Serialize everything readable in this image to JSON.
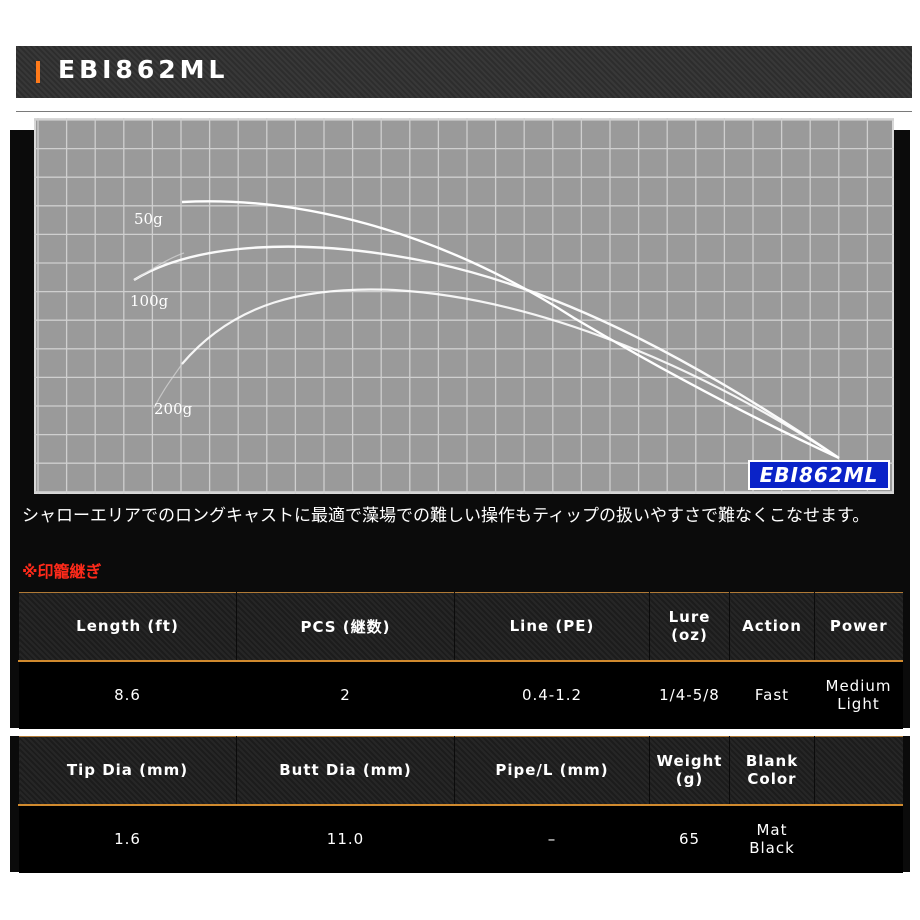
{
  "header": {
    "title": "EBI862ML"
  },
  "chart": {
    "labels": [
      "50g",
      "100g",
      "200g"
    ],
    "badge": "EBI862ML",
    "colors": {
      "bg": "#9a9a9a",
      "grid": "#cfcfcf",
      "curve": "#ffffff",
      "badge": "#0a23c8"
    }
  },
  "description": "シャローエリアでのロングキャストに最適で藻場での難しい操作もティップの扱いやすさで難なくこなせます。",
  "note": "※印籠継ぎ",
  "spec1": {
    "headers": [
      "Length (ft)",
      "PCS (継数)",
      "Line (PE)",
      "Lure (oz)",
      "Action",
      "Power"
    ],
    "values": [
      "8.6",
      "2",
      "0.4-1.2",
      "1/4-5/8",
      "Fast",
      "Medium Light"
    ]
  },
  "spec2": {
    "headers": [
      "Tip Dia (mm)",
      "Butt Dia (mm)",
      "Pipe/L (mm)",
      "Weight (g)",
      "Blank Color",
      ""
    ],
    "values": [
      "1.6",
      "11.0",
      "–",
      "65",
      "Mat Black",
      ""
    ]
  }
}
